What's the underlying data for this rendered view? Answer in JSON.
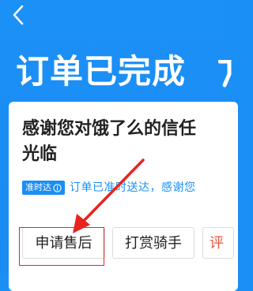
{
  "header": {
    "title": "订单已完成",
    "back_icon": "chevron-left-icon",
    "background_color": "#1a8ff5"
  },
  "card": {
    "message": "感谢您对饿了么的信任\n光临",
    "message_line1": "感谢您对饿了么的信任",
    "message_line2": "光临",
    "ontime_badge": "准时达",
    "ontime_badge_icon": "info-icon",
    "ontime_text": "订单已准时送达，感谢您"
  },
  "actions": {
    "after_sale_label": "申请售后",
    "tip_rider_label": "打赏骑手",
    "review_label": "评"
  },
  "annotation": {
    "highlight_color": "#e8231f",
    "arrow_color": "#e8231f"
  }
}
